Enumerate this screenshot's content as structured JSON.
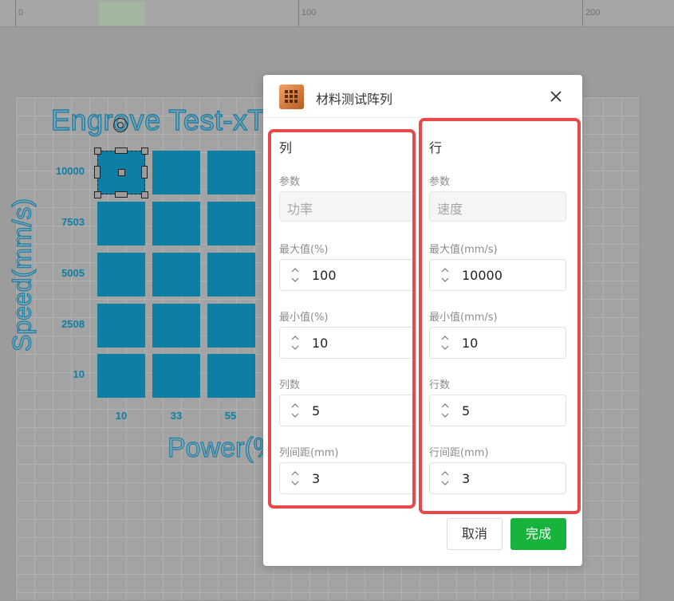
{
  "ruler": {
    "labels": [
      "0",
      "100",
      "200"
    ]
  },
  "canvas": {
    "title": "Engrove Test-xT",
    "y_axis_label": "Speed(mm/s)",
    "x_axis_label": "Power(%",
    "y_ticks": [
      "10000",
      "7503",
      "5005",
      "2508",
      "10"
    ],
    "x_ticks": [
      "10",
      "33",
      "55"
    ],
    "accent_color": "#0d7ea4"
  },
  "dialog": {
    "title": "材料测试阵列",
    "columns": {
      "heading": "列",
      "param_label": "参数",
      "param_value": "功率",
      "max_label": "最大值(%)",
      "max_value": "100",
      "min_label": "最小值(%)",
      "min_value": "10",
      "count_label": "列数",
      "count_value": "5",
      "spacing_label": "列间距(mm)",
      "spacing_value": "3"
    },
    "rows": {
      "heading": "行",
      "param_label": "参数",
      "param_value": "速度",
      "max_label": "最大值(mm/s)",
      "max_value": "10000",
      "min_label": "最小值(mm/s)",
      "min_value": "10",
      "count_label": "行数",
      "count_value": "5",
      "spacing_label": "行间距(mm)",
      "spacing_value": "3"
    },
    "cancel_label": "取消",
    "done_label": "完成",
    "highlight_color": "#e8484a",
    "primary_color": "#17b33d"
  }
}
